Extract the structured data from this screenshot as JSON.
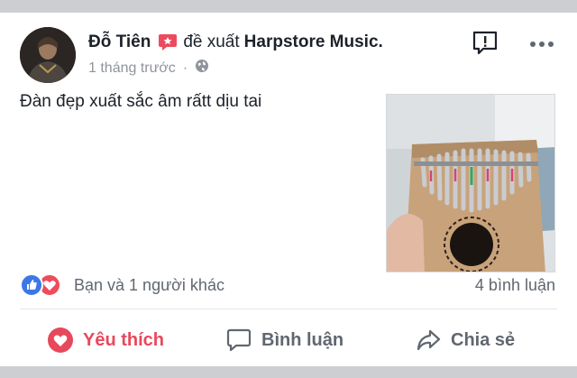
{
  "post": {
    "author": "Đỗ Tiên",
    "verb": "đề xuất",
    "page_name": "Harpstore Music.",
    "timestamp": "1 tháng trước",
    "separator": "·",
    "privacy_icon": "globe-icon",
    "text": "Đàn đẹp xuất sắc âm rấtt dịu tai"
  },
  "reactions": {
    "summary": "Bạn và 1 người khác",
    "icons": [
      "like-icon",
      "love-icon"
    ],
    "comments": "4 bình luận"
  },
  "actions": {
    "like": "Yêu thích",
    "comment": "Bình luận",
    "share": "Chia sẻ"
  },
  "colors": {
    "accent": "#e8485c",
    "text": "#1d2129",
    "muted": "#90949c",
    "like_blue": "#3b78e7"
  }
}
